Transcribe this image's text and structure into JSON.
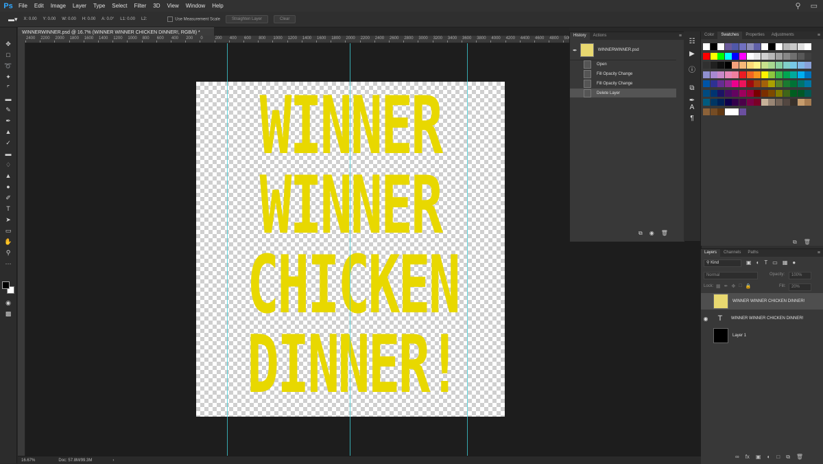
{
  "app": {
    "logo": "Ps"
  },
  "menu": [
    "File",
    "Edit",
    "Image",
    "Layer",
    "Type",
    "Select",
    "Filter",
    "3D",
    "View",
    "Window",
    "Help"
  ],
  "options": {
    "x": "X: 0.00",
    "y": "Y: 0.00",
    "w": "W: 0.00",
    "h": "H: 0.00",
    "a": "A: 0.0°",
    "l1": "L1: 0.00",
    "l2": "L2:",
    "measurement_scale": "Use Measurement Scale",
    "straighten": "Straighten Layer",
    "clear": "Clear"
  },
  "document": {
    "tab_title": "WINNERWINNER.psd @ 16.7% (WINNER WINNER CHICKEN DINNER!, RGB/8) *"
  },
  "ruler": {
    "h_labels": [
      "2400",
      "2200",
      "2000",
      "1800",
      "1600",
      "1400",
      "1200",
      "1000",
      "800",
      "600",
      "400",
      "200",
      "0",
      "200",
      "400",
      "600",
      "800",
      "1000",
      "1200",
      "1400",
      "1600",
      "1800",
      "2000",
      "2200",
      "2400",
      "2600",
      "2800",
      "3000",
      "3200",
      "3400",
      "3600",
      "3800",
      "4000",
      "4200",
      "4400",
      "4600",
      "4800",
      "5000"
    ]
  },
  "canvas": {
    "lines": [
      "WINNER",
      "WINNER",
      "CHICKEN",
      "DINNER!"
    ],
    "text_color": "#e8d800",
    "guide_color": "#3fd0d8"
  },
  "status": {
    "zoom": "16.67%",
    "doc": "Doc: 57.8M/99.3M",
    "arrow": "›"
  },
  "history": {
    "tabs": [
      "History",
      "Actions"
    ],
    "snapshot": "WINNERWINNER.psd",
    "steps": [
      "Open",
      "Fill Opacity Change",
      "Fill Opacity Change",
      "Delete Layer"
    ],
    "selected_index": 3
  },
  "swatches": {
    "tabs": [
      "Color",
      "Swatches",
      "Properties",
      "Adjustments"
    ],
    "active_tab": "Swatches",
    "colors": [
      [
        "#ffffff",
        "#000000",
        "#ffffff",
        "#6b5a9b",
        "#5058a8",
        "#7070c0",
        "#8c8cb8",
        "#6060a8",
        "#ffffff",
        "#000000",
        "#ffffff",
        "#b8b8b8",
        "#c8c8c8",
        "#e0e0e0",
        "#ffffff"
      ],
      [
        "#ff0000",
        "#ffff00",
        "#00ff00",
        "#00ffff",
        "#0000ff",
        "#ff00ff",
        "#ffffff",
        "#e8e8e8",
        "#d0d0d0",
        "#b8b8b8",
        "#a0a0a0",
        "#888888",
        "#707070",
        "#585858",
        "#404040"
      ],
      [
        "#303030",
        "#202020",
        "#101010",
        "#000000",
        "#f4a07c",
        "#f8b878",
        "#fcd878",
        "#fff488",
        "#c8e08c",
        "#a8d890",
        "#88d0a0",
        "#80d0c8",
        "#78c8e8",
        "#80b8e8",
        "#88a0d8"
      ],
      [
        "#9090d0",
        "#a888d0",
        "#c888c8",
        "#e888b8",
        "#f080a0",
        "#ec1c24",
        "#f26522",
        "#f7941d",
        "#fff200",
        "#8dc63f",
        "#39b54a",
        "#00a651",
        "#00a99d",
        "#00aeef",
        "#0072bc"
      ],
      [
        "#0054a6",
        "#2e3192",
        "#662d91",
        "#92278f",
        "#ec008c",
        "#ed145b",
        "#9e0b0f",
        "#a0410d",
        "#a3620a",
        "#aba000",
        "#598527",
        "#1a7b30",
        "#007236",
        "#00746b",
        "#0076a3"
      ],
      [
        "#004b80",
        "#003471",
        "#1b1464",
        "#440e62",
        "#630460",
        "#9e005d",
        "#9e0039",
        "#790000",
        "#7b2e00",
        "#7d4900",
        "#827b00",
        "#406618",
        "#005e20",
        "#005826",
        "#005952"
      ],
      [
        "#005b7f",
        "#003663",
        "#002157",
        "#0d004c",
        "#32004b",
        "#4b0049",
        "#7b0046",
        "#7a0026",
        "#c7b299",
        "#998675",
        "#736357",
        "#534741",
        "#37302a",
        "#c69c6d",
        "#a67c52"
      ],
      [
        "#8c6239",
        "#754c24",
        "#603813",
        "#ffffff",
        "#ffffff",
        "#6b4fa0"
      ]
    ]
  },
  "layers": {
    "tabs": [
      "Layers",
      "Channels",
      "Paths"
    ],
    "kind_label": "Kind",
    "blend_mode": "Normal",
    "opacity_label": "Opacity:",
    "opacity_value": "100%",
    "lock_label": "Lock:",
    "fill_label": "Fill:",
    "fill_value": "20%",
    "items": [
      {
        "name": "WINNER WINNER CHICKEN DINNER!",
        "visible": false,
        "thumb": "yellow",
        "selected": true
      },
      {
        "name": "WINNER WINNER CHICKEN DINNER!",
        "visible": true,
        "thumb": "text",
        "selected": false
      },
      {
        "name": "Layer 1",
        "visible": false,
        "thumb": "black",
        "selected": false
      }
    ]
  }
}
